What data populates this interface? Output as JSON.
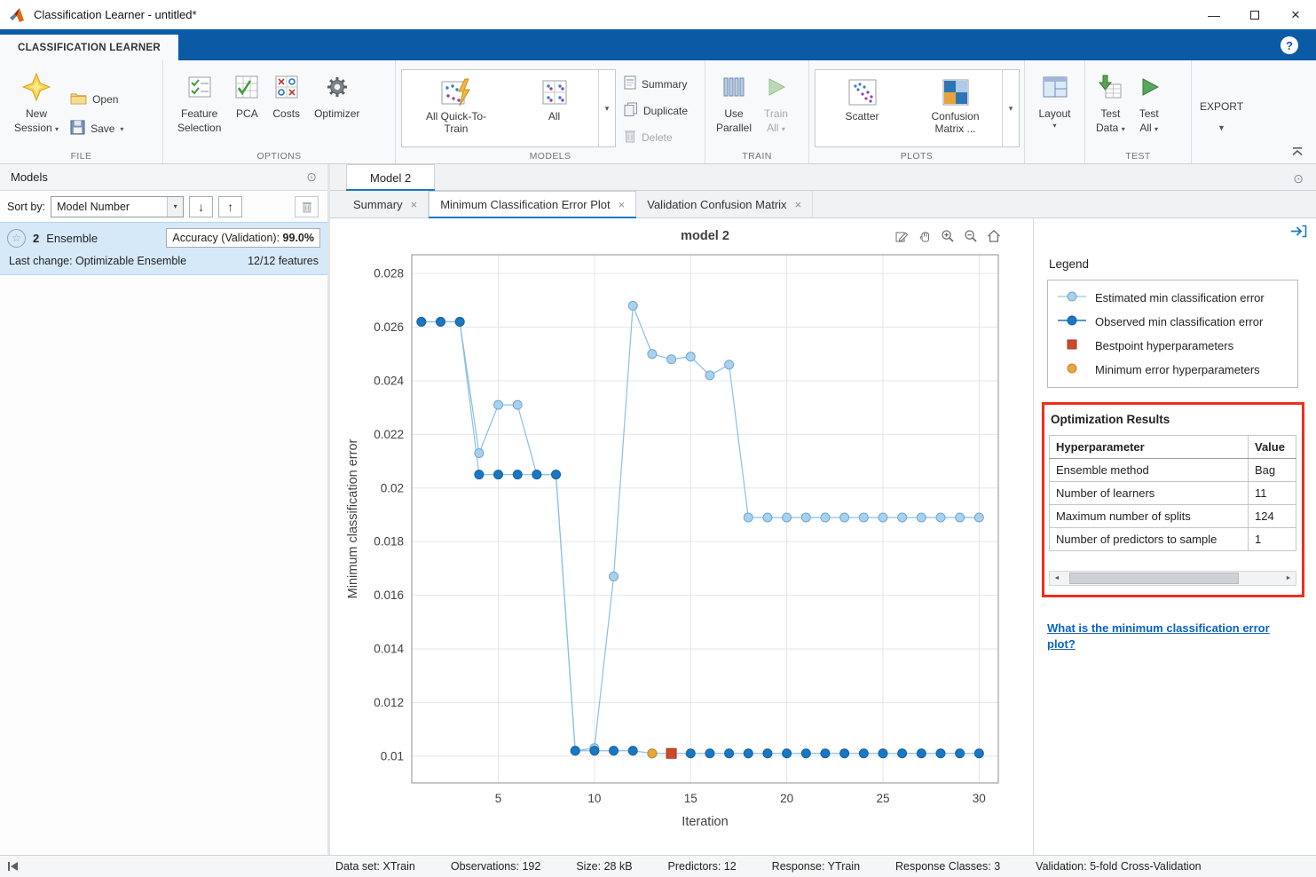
{
  "titlebar": {
    "title": "Classification Learner - untitled*"
  },
  "icons": {
    "minimize": "—",
    "close": "×",
    "help": "?",
    "caret_down": "▾",
    "caret_down_large": "▼",
    "sort_descending": "↓",
    "sort_ascending": "↑",
    "panel_circle": "⊙",
    "tab_close": "×",
    "scroll_left": "◄",
    "scroll_right": "►",
    "star": "☆"
  },
  "colors": {
    "accent_blue": "#1b7ac2",
    "ribbon_blue": "#0b5aa5",
    "selection_blue": "#d6e9f8",
    "highlight_red": "#ee2e1e"
  },
  "ribbon": {
    "tab": "CLASSIFICATION LEARNER",
    "sections": {
      "file": {
        "label": "FILE",
        "new_session_line1": "New",
        "new_session_line2": "Session",
        "open": "Open",
        "save": "Save"
      },
      "options": {
        "label": "OPTIONS",
        "feature_line1": "Feature",
        "feature_line2": "Selection",
        "pca": "PCA",
        "costs": "Costs",
        "optimizer": "Optimizer"
      },
      "models": {
        "label": "MODELS",
        "all_quick_line1": "All Quick-To-",
        "all_quick_line2": "Train",
        "all": "All",
        "summary": "Summary",
        "duplicate": "Duplicate",
        "delete": "Delete"
      },
      "train": {
        "label": "TRAIN",
        "use_parallel_line1": "Use",
        "use_parallel_line2": "Parallel",
        "train_line1": "Train",
        "train_line2": "All"
      },
      "plots": {
        "label": "PLOTS",
        "scatter": "Scatter",
        "confusion_line1": "Confusion",
        "confusion_line2": "Matrix",
        "more": "..."
      },
      "layout": {
        "label": "",
        "button": "Layout"
      },
      "test": {
        "label": "TEST",
        "test_data_line1": "Test",
        "test_data_line2": "Data",
        "test_all_line1": "Test",
        "test_all_line2": "All"
      },
      "export": {
        "label": "EXPORT"
      }
    }
  },
  "models_panel": {
    "title": "Models",
    "sort_by": "Sort by:",
    "sort_value": "Model Number",
    "card": {
      "number": "2",
      "type": "Ensemble",
      "accuracy_label": "Accuracy (Validation):",
      "accuracy_value": "99.0%",
      "last_change": "Last change: Optimizable Ensemble",
      "features": "12/12 features"
    }
  },
  "document": {
    "tab": "Model 2",
    "subtabs": [
      {
        "label": "Summary"
      },
      {
        "label": "Minimum Classification Error Plot"
      },
      {
        "label": "Validation Confusion Matrix"
      }
    ]
  },
  "chart_data": {
    "type": "line",
    "title": "model 2",
    "xlabel": "Iteration",
    "ylabel": "Minimum classification error",
    "xlim": [
      0.5,
      31
    ],
    "ylim": [
      0.009,
      0.0287
    ],
    "xticks": [
      5,
      10,
      15,
      20,
      25,
      30
    ],
    "yticks": [
      0.01,
      0.012,
      0.014,
      0.016,
      0.018,
      0.02,
      0.022,
      0.024,
      0.026,
      0.028
    ],
    "grid": true,
    "legend_position": "outside-right",
    "series": [
      {
        "name": "Estimated min classification error",
        "marker": "circle",
        "fill": "#a9d1ec",
        "edge": "#6fa8d4",
        "line": "#8bbfe4",
        "x": [
          1,
          2,
          3,
          4,
          5,
          6,
          7,
          8,
          9,
          10,
          11,
          12,
          13,
          14,
          15,
          16,
          17,
          18,
          19,
          20,
          21,
          22,
          23,
          24,
          25,
          26,
          27,
          28,
          29,
          30
        ],
        "y": [
          0.0262,
          0.0262,
          0.0262,
          0.0213,
          0.0231,
          0.0231,
          0.0205,
          0.0205,
          0.0102,
          0.0103,
          0.0167,
          0.0268,
          0.025,
          0.0248,
          0.0249,
          0.0242,
          0.0246,
          0.0189,
          0.0189,
          0.0189,
          0.0189,
          0.0189,
          0.0189,
          0.0189,
          0.0189,
          0.0189,
          0.0189,
          0.0189,
          0.0189,
          0.0189
        ]
      },
      {
        "name": "Observed min classification error",
        "marker": "circle",
        "fill": "#1a77c2",
        "edge": "#15629f",
        "line": "#8bbfe4",
        "x": [
          1,
          2,
          3,
          4,
          5,
          6,
          7,
          8,
          9,
          10,
          11,
          12,
          13,
          14,
          15,
          16,
          17,
          18,
          19,
          20,
          21,
          22,
          23,
          24,
          25,
          26,
          27,
          28,
          29,
          30
        ],
        "y": [
          0.0262,
          0.0262,
          0.0262,
          0.0205,
          0.0205,
          0.0205,
          0.0205,
          0.0205,
          0.0102,
          0.0102,
          0.0102,
          0.0102,
          0.0101,
          0.0101,
          0.0101,
          0.0101,
          0.0101,
          0.0101,
          0.0101,
          0.0101,
          0.0101,
          0.0101,
          0.0101,
          0.0101,
          0.0101,
          0.0101,
          0.0101,
          0.0101,
          0.0101,
          0.0101
        ]
      },
      {
        "name": "Bestpoint hyperparameters",
        "marker": "square",
        "fill": "#cd4a28",
        "edge": "#a93a1e",
        "x": [
          14
        ],
        "y": [
          0.0101
        ]
      },
      {
        "name": "Minimum error hyperparameters",
        "marker": "circle",
        "fill": "#e9a63b",
        "edge": "#c78a26",
        "x": [
          13
        ],
        "y": [
          0.0101
        ]
      }
    ]
  },
  "side_panel": {
    "legend_title": "Legend",
    "legend_items": [
      {
        "label": "Estimated min classification error",
        "marker": "circle",
        "fill": "#a9d1ec",
        "edge": "#6fa8d4",
        "line": true
      },
      {
        "label": "Observed min classification error",
        "marker": "circle",
        "fill": "#1a77c2",
        "edge": "#15629f",
        "line": true
      },
      {
        "label": "Bestpoint hyperparameters",
        "marker": "square",
        "fill": "#cd4a28",
        "edge": "#a93a1e",
        "line": false
      },
      {
        "label": "Minimum error hyperparameters",
        "marker": "circle",
        "fill": "#e9a63b",
        "edge": "#c78a26",
        "line": false
      }
    ],
    "results_title": "Optimization Results",
    "table": {
      "columns": [
        "Hyperparameter",
        "Value"
      ],
      "rows": [
        [
          "Ensemble method",
          "Bag"
        ],
        [
          "Number of learners",
          "11"
        ],
        [
          "Maximum number of splits",
          "124"
        ],
        [
          "Number of predictors to sample",
          "1"
        ]
      ]
    },
    "help_link": "What is the minimum classification error plot?"
  },
  "statusbar": {
    "items": [
      "Data set: XTrain",
      "Observations: 192",
      "Size: 28 kB",
      "Predictors: 12",
      "Response: YTrain",
      "Response Classes: 3",
      "Validation: 5-fold Cross-Validation"
    ]
  }
}
